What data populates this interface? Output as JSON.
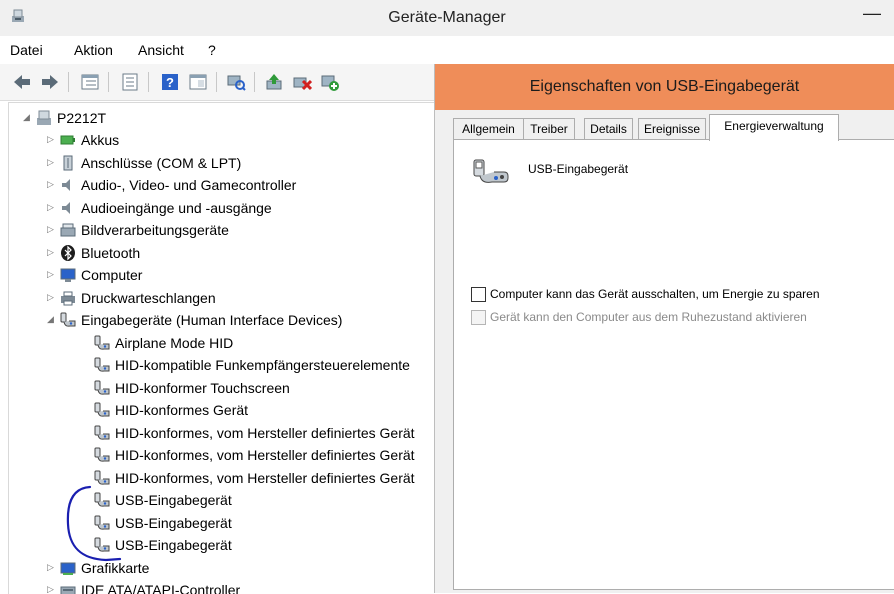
{
  "window": {
    "title": "Geräte-Manager",
    "minimize_glyph": "—"
  },
  "menu": {
    "items": [
      "Datei",
      "Aktion",
      "Ansicht",
      "?"
    ]
  },
  "toolbar": {
    "buttons": [
      "back-icon",
      "forward-icon",
      "properties-grid-icon",
      "show-details-icon",
      "help-icon",
      "view-icon",
      "scan-hardware-icon",
      "update-driver-icon",
      "uninstall-device-icon",
      "add-legacy-icon"
    ]
  },
  "tree": {
    "root": "P2212T",
    "items": [
      {
        "label": "Akkus",
        "icon": "battery-icon",
        "level": 1,
        "expander": "collapsed"
      },
      {
        "label": "Anschlüsse (COM & LPT)",
        "icon": "port-icon",
        "level": 1,
        "expander": "collapsed"
      },
      {
        "label": "Audio-, Video- und Gamecontroller",
        "icon": "speaker-icon",
        "level": 1,
        "expander": "collapsed"
      },
      {
        "label": "Audioeingänge und -ausgänge",
        "icon": "speaker-icon",
        "level": 1,
        "expander": "collapsed"
      },
      {
        "label": "Bildverarbeitungsgeräte",
        "icon": "scanner-icon",
        "level": 1,
        "expander": "collapsed"
      },
      {
        "label": "Bluetooth",
        "icon": "bluetooth-icon",
        "level": 1,
        "expander": "collapsed"
      },
      {
        "label": "Computer",
        "icon": "computer-icon",
        "level": 1,
        "expander": "collapsed"
      },
      {
        "label": "Druckwarteschlangen",
        "icon": "printer-icon",
        "level": 1,
        "expander": "collapsed"
      },
      {
        "label": "Eingabegeräte (Human Interface Devices)",
        "icon": "hid-icon",
        "level": 1,
        "expander": "expanded"
      },
      {
        "label": "Airplane Mode HID",
        "icon": "hid-icon",
        "level": 2,
        "expander": "none"
      },
      {
        "label": "HID-kompatible Funkempfängersteuerelemente",
        "icon": "hid-icon",
        "level": 2,
        "expander": "none"
      },
      {
        "label": "HID-konformer Touchscreen",
        "icon": "hid-icon",
        "level": 2,
        "expander": "none"
      },
      {
        "label": "HID-konformes Gerät",
        "icon": "hid-icon",
        "level": 2,
        "expander": "none"
      },
      {
        "label": "HID-konformes, vom Hersteller definiertes Gerät",
        "icon": "hid-icon",
        "level": 2,
        "expander": "none"
      },
      {
        "label": "HID-konformes, vom Hersteller definiertes Gerät",
        "icon": "hid-icon",
        "level": 2,
        "expander": "none"
      },
      {
        "label": "HID-konformes, vom Hersteller definiertes Gerät",
        "icon": "hid-icon",
        "level": 2,
        "expander": "none"
      },
      {
        "label": "USB-Eingabegerät",
        "icon": "hid-icon",
        "level": 2,
        "expander": "none"
      },
      {
        "label": "USB-Eingabegerät",
        "icon": "hid-icon",
        "level": 2,
        "expander": "none"
      },
      {
        "label": "USB-Eingabegerät",
        "icon": "hid-icon",
        "level": 2,
        "expander": "none"
      },
      {
        "label": "Grafikkarte",
        "icon": "display-adapter-icon",
        "level": 1,
        "expander": "collapsed"
      },
      {
        "label": "IDE ATA/ATAPI-Controller",
        "icon": "ide-controller-icon",
        "level": 1,
        "expander": "collapsed"
      }
    ]
  },
  "dialog": {
    "title": "Eigenschaften von USB-Eingabegerät",
    "tabs": [
      "Allgemein",
      "Treiber",
      "Details",
      "Ereignisse",
      "Energieverwaltung"
    ],
    "active_tab": "Energieverwaltung",
    "device_name": "USB-Eingabegerät",
    "options": [
      {
        "label": "Computer kann das Gerät ausschalten, um Energie zu sparen",
        "checked": false,
        "enabled": true
      },
      {
        "label": "Gerät kann den Computer aus dem Ruhezustand aktivieren",
        "checked": false,
        "enabled": false
      }
    ]
  },
  "colors": {
    "dialog_title_bg": "#ef8d59",
    "annotation_stroke": "#1a1fb0"
  }
}
